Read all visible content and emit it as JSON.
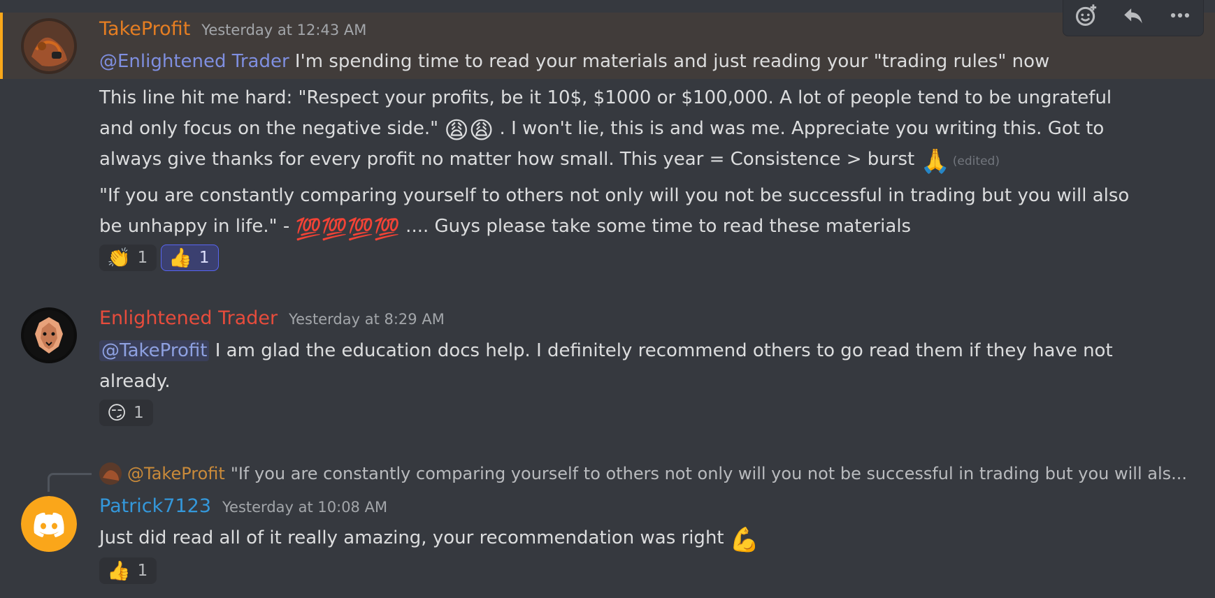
{
  "messages": [
    {
      "username": "TakeProfit",
      "username_color": "#e67e22",
      "timestamp": "Yesterday at 12:43 AM",
      "mention": "@Enlightened Trader",
      "line1": " I'm spending time to read your materials and just reading your \"trading rules\" now",
      "para2_line1": "This line hit me hard: \"Respect your profits, be it 10$, $1000 or $100,000. A lot of people tend to be ungrateful",
      "para2_line2_pre": "and only focus on the negative side.\" ",
      "para2_line2_emoji": "😩😩",
      "para2_line2_post": " . I won't lie, this is and was me. Appreciate you writing this. Got to",
      "para2_line3": "always give thanks for every profit no matter how small. This year = Consistence > burst ",
      "para2_line3_emoji": "🙏",
      "edited_label": "(edited)",
      "para3_line1": "\"If you are constantly comparing yourself to others not only will you not be successful in trading but you will also",
      "para3_line2_pre": "be unhappy in life.\" - ",
      "para3_line2_emoji": "💯💯💯💯",
      "para3_line2_post": " .... Guys please take some time to read these materials",
      "reactions": [
        {
          "emoji": "👏",
          "count": "1",
          "me": false
        },
        {
          "emoji": "👍",
          "count": "1",
          "me": true
        }
      ]
    },
    {
      "username": "Enlightened Trader",
      "username_color": "#e74c3c",
      "timestamp": "Yesterday at 8:29 AM",
      "mention": "@TakeProfit",
      "line1": " I am glad the education docs help. I definitely recommend others to go read them if they have not",
      "line2": "already.",
      "reactions": [
        {
          "emoji": "😏",
          "count": "1",
          "me": false
        }
      ]
    },
    {
      "reply_mention": "@TakeProfit",
      "reply_text": "\"If you are constantly comparing yourself to others not only will you not be successful in trading but you will als...",
      "username": "Patrick7123",
      "username_color": "#3498db",
      "timestamp": "Yesterday at 10:08 AM",
      "line1": "Just did read all of it really amazing, your recommendation was right ",
      "line1_emoji": "💪",
      "reactions": [
        {
          "emoji": "👍",
          "count": "1",
          "me": false
        }
      ]
    }
  ],
  "toolbar": {
    "icons": [
      "add-reaction-icon",
      "reply-icon",
      "more-icon"
    ]
  }
}
